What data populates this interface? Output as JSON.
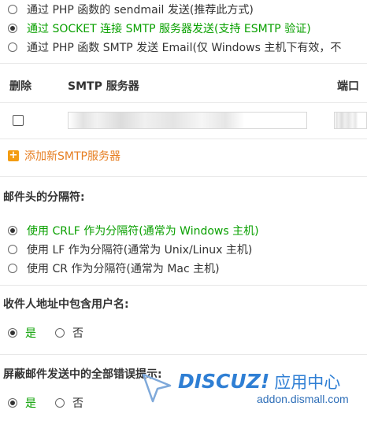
{
  "mail_send_method": {
    "options": [
      {
        "label": "通过 PHP 函数的 sendmail 发送(推荐此方式)",
        "checked": false,
        "highlight": false
      },
      {
        "label": "通过 SOCKET 连接 SMTP 服务器发送(支持 ESMTP 验证)",
        "checked": true,
        "highlight": true
      },
      {
        "label": "通过 PHP 函数 SMTP 发送 Email(仅 Windows 主机下有效，不",
        "checked": false,
        "highlight": false
      }
    ]
  },
  "smtp_table": {
    "headers": {
      "delete": "删除",
      "server": "SMTP 服务器",
      "port": "端口"
    },
    "add_label": "添加新SMTP服务器"
  },
  "delimiter": {
    "title": "邮件头的分隔符:",
    "options": [
      {
        "label": "使用 CRLF 作为分隔符(通常为 Windows 主机)",
        "checked": true,
        "highlight": true
      },
      {
        "label": "使用 LF 作为分隔符(通常为 Unix/Linux 主机)",
        "checked": false,
        "highlight": false
      },
      {
        "label": "使用 CR 作为分隔符(通常为 Mac 主机)",
        "checked": false,
        "highlight": false
      }
    ]
  },
  "include_username": {
    "title": "收件人地址中包含用户名:",
    "yes": "是",
    "no": "否",
    "selected": "yes"
  },
  "silent_errors": {
    "title": "屏蔽邮件发送中的全部错误提示:",
    "yes": "是",
    "no": "否",
    "selected": "yes"
  },
  "watermark": {
    "logo": "DISCUZ!",
    "logo_suffix": "应用中心",
    "url": "addon.dismall.com"
  },
  "colors": {
    "accent_green": "#09a000",
    "add_orange": "#e67e22",
    "watermark_blue": "#2f7fd4"
  }
}
